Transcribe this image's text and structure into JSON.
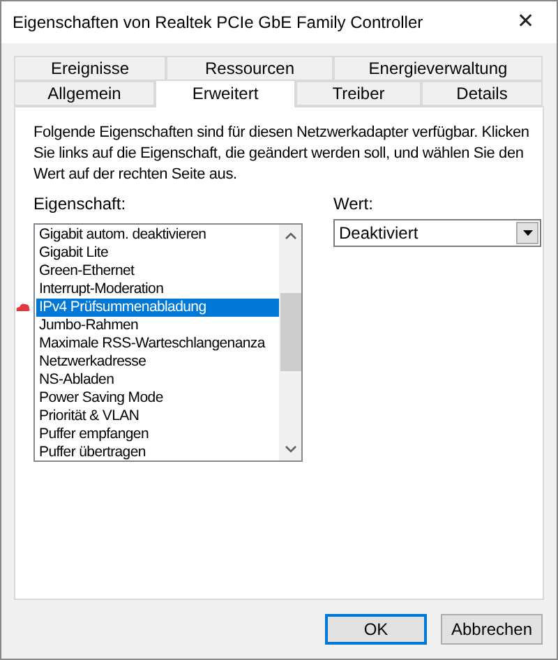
{
  "window": {
    "title": "Eigenschaften von Realtek PCIe GbE Family Controller",
    "close": "✕"
  },
  "tab_rows": [
    [
      {
        "label": "Ereignisse",
        "selected": false
      },
      {
        "label": "Ressourcen",
        "selected": false
      },
      {
        "label": "Energieverwaltung",
        "selected": false
      }
    ],
    [
      {
        "label": "Allgemein",
        "selected": false
      },
      {
        "label": "Erweitert",
        "selected": true
      },
      {
        "label": "Treiber",
        "selected": false
      },
      {
        "label": "Details",
        "selected": false
      }
    ]
  ],
  "description": "Folgende Eigenschaften sind für diesen Netzwerkadapter verfügbar. Klicken Sie links auf die Eigenschaft, die geändert werden soll, und wählen Sie den Wert auf der rechten Seite aus.",
  "property_label": "Eigenschaft:",
  "properties": [
    {
      "label": "Gigabit autom. deaktivieren",
      "selected": false
    },
    {
      "label": "Gigabit Lite",
      "selected": false
    },
    {
      "label": "Green-Ethernet",
      "selected": false
    },
    {
      "label": "Interrupt-Moderation",
      "selected": false
    },
    {
      "label": "IPv4 Prüfsummenabladung",
      "selected": true
    },
    {
      "label": "Jumbo-Rahmen",
      "selected": false
    },
    {
      "label": "Maximale RSS-Warteschlangenanza",
      "selected": false
    },
    {
      "label": "Netzwerkadresse",
      "selected": false
    },
    {
      "label": "NS-Abladen",
      "selected": false
    },
    {
      "label": "Power Saving Mode",
      "selected": false
    },
    {
      "label": "Priorität & VLAN",
      "selected": false
    },
    {
      "label": "Puffer empfangen",
      "selected": false
    },
    {
      "label": "Puffer übertragen",
      "selected": false
    }
  ],
  "value_label": "Wert:",
  "value": "Deaktiviert",
  "buttons": [
    {
      "label": "OK",
      "default": true
    },
    {
      "label": "Abbrechen",
      "default": false
    }
  ]
}
